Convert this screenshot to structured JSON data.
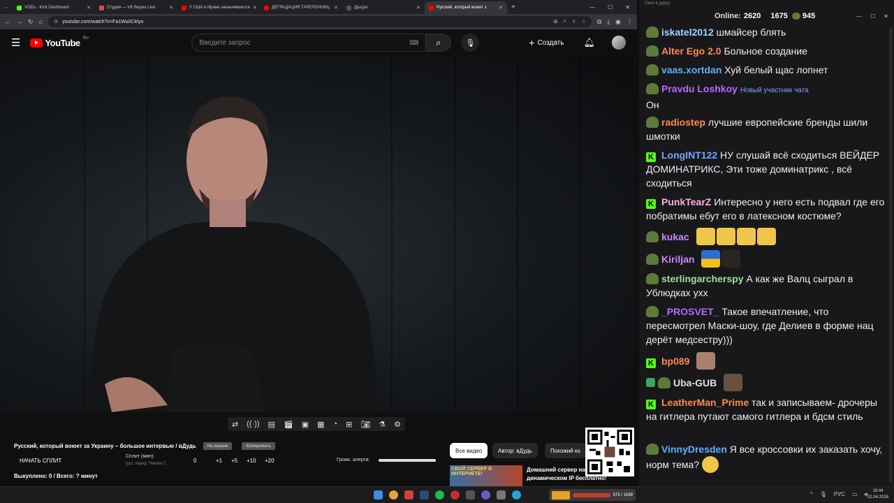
{
  "browser": {
    "tabs": [
      {
        "label": "VODs - Kick Dashboard",
        "color": "#53fc18"
      },
      {
        "label": "Студия — VK Видео Live",
        "color": "#e04b5a"
      },
      {
        "label": "У США в Иране заканчиваются",
        "color": "#ff0000"
      },
      {
        "label": "ДЕГРАДАЦИЯ ТАРЕЛОЧНИЦ",
        "color": "#ff0000"
      },
      {
        "label": "Д(ы)ра",
        "color": "#444"
      },
      {
        "label": "Русский, который воюет з",
        "color": "#ff0000"
      }
    ],
    "url": "youtube.com/watch?v=Fa1Wu0Cktyo"
  },
  "youtube": {
    "logo": "YouTube",
    "region": "RU",
    "search_placeholder": "Введите запрос",
    "create_label": "Создать"
  },
  "video": {
    "title": "Русский, который воюет за Украину – большое интервью / вДудь",
    "pill1": "На экране",
    "pill2": "Копировать",
    "split_label": "НАЧАТЬ СПЛИТ",
    "split_min_label": "Сплит (мин):",
    "split_hint": "(уст. перед \"Начать\")",
    "split_values": [
      "0",
      "+1",
      "+5",
      "+10",
      "+20"
    ],
    "alert_volume_label": "Громк. алерта:",
    "bought_label": "Выкуплено: 0 / Всего: ? минут",
    "alert_volume": 1.0
  },
  "filters": [
    "Все видео",
    "Автор: вДудь",
    "Похожий ко"
  ],
  "recommended": {
    "thumb_text": "СВОЙ СЕРВЕР В ИНТЕРНЕТЕ!",
    "title_line1": "Домашний сервер на",
    "title_line2": "динамическом IP бесплатно!"
  },
  "chat": {
    "window_title": "Окно в дурку",
    "online_label": "Online:",
    "online_count": "2620",
    "kick_count": "1675",
    "other_count": "945",
    "messages": [
      {
        "badge": "pepe",
        "name": "iskatel2012",
        "color": "#9ed4ff",
        "text": "шмайсер блять"
      },
      {
        "badge": "pepe",
        "name": "Alter Ego 2.0",
        "color": "#ff8a4c",
        "text": "Больное создание"
      },
      {
        "badge": "pepe",
        "name": "vaas.xortdan",
        "color": "#5fb0ff",
        "text": "Хуй белый щас лопнет"
      },
      {
        "badge": "pepe",
        "name": "Pravdu Loshkoy",
        "color": "#b26cff",
        "note": "Новый участник чата",
        "text": "Он"
      },
      {
        "badge": "pepe",
        "name": "radiostep",
        "color": "#ff8a4c",
        "text": "лучшие европейские бренды шили шмотки"
      },
      {
        "badge": "kick",
        "name": "LongINT122",
        "color": "#6fa8ff",
        "text": "НУ слушай всё сходиться ВЕЙДЕР ДОМИНАТРИКС, Эти тоже доминатрикс , всё сходиться"
      },
      {
        "badge": "kick",
        "name": "PunkTearZ",
        "color": "#ffb0e0",
        "text": "Интересно у него есть подвал где его побратимы ебут его в латексном костюме?"
      },
      {
        "badge": "pepe",
        "name": "kukac",
        "color": "#c98bff",
        "text": ""
      },
      {
        "badge": "pepe",
        "name": "Kiriljan",
        "color": "#c98bff",
        "text": ""
      },
      {
        "badge": "pepe",
        "name": "sterlingarcherspy",
        "color": "#9ee0a0",
        "text": "А как же Валц сыграл в Ублюдках ухх"
      },
      {
        "badge": "pepe",
        "name": "_PROSVET_",
        "color": "#b26cff",
        "text": "Такое впечатление, что пересмотрел Маски-шоу, где Делиев в форме нац дерёт медсестру)))"
      },
      {
        "badge": "kick",
        "name": "bp089",
        "color": "#ff8a4c",
        "text": ""
      },
      {
        "badge": "shield",
        "name": "Uba-GUB",
        "color": "#e0e0e0",
        "text": ""
      },
      {
        "badge": "kick",
        "name": "LeatherMan_Prime",
        "color": "#ff8a4c",
        "text": "так и записываем- дрочеры на гитлера путают самого гитлера и бдсм стиль"
      },
      {
        "badge": "pepe",
        "name": "VinnyDresden",
        "color": "#5fb0ff",
        "text": "Я все кроссовки их заказать хочу, норм тема?"
      }
    ]
  },
  "taskbar": {
    "lang": "РУС",
    "time": "18:44",
    "date": "02.04.2026",
    "game_counter": "575 / 1599"
  }
}
